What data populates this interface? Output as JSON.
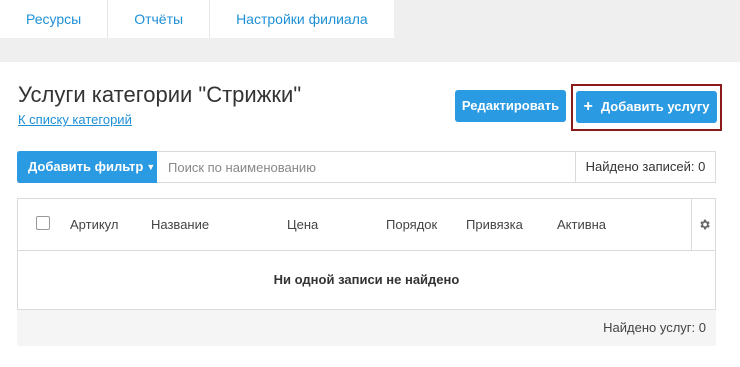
{
  "tabs": [
    {
      "label": "Ресурсы"
    },
    {
      "label": "Отчёты"
    },
    {
      "label": "Настройки филиала"
    }
  ],
  "header": {
    "title": "Услуги категории \"Стрижки\"",
    "back_link": "К списку категорий",
    "edit_button": "Редактировать",
    "add_button": "Добавить услугу"
  },
  "filter": {
    "add_filter_label": "Добавить фильтр",
    "search_placeholder": "Поиск по наименованию",
    "found_records": "Найдено записей: 0"
  },
  "table": {
    "columns": [
      "Артикул",
      "Название",
      "Цена",
      "Порядок",
      "Привязка",
      "Активна"
    ],
    "empty_message": "Ни одной записи не найдено"
  },
  "footer": {
    "found_services": "Найдено услуг: 0"
  },
  "colors": {
    "accent": "#2a9ae2",
    "highlight_border": "#8b1a1a",
    "link": "#1e90d6"
  },
  "icons": {
    "plus": "plus-icon",
    "caret": "caret-down-icon",
    "settings": "gear-icon"
  }
}
